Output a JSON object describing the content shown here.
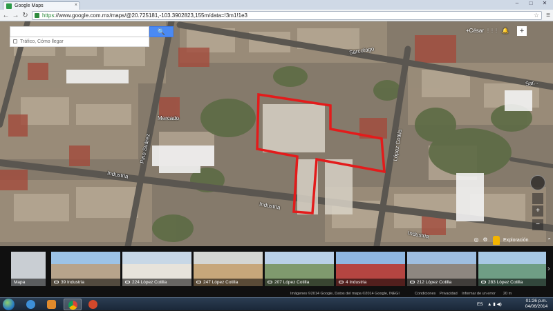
{
  "browser": {
    "tab_title": "Google Maps",
    "tab_close": "×",
    "url_scheme": "https",
    "url_rest": "://www.google.com.mx/maps/@20.725181,-103.3902823,155m/data=!3m1!1e3",
    "back": "←",
    "forward": "→",
    "reload": "↻",
    "star": "☆",
    "menu": "≡",
    "window_min": "–",
    "window_max": "□",
    "window_close": "✕"
  },
  "maps": {
    "search_placeholder": "",
    "search_button": "🔍",
    "traffic_label": "Tráfico, Cómo llegar",
    "user": "+César",
    "apps_icon": "⋮⋮⋮",
    "notif_icon": "🔔",
    "share_plus": "+",
    "explore_label": "Exploración",
    "explore_chevron": "⌃",
    "zoom_in": "+",
    "zoom_out": "−"
  },
  "streets": [
    {
      "name": "Sarcofago"
    },
    {
      "name": "Sar..."
    },
    {
      "name": "Industria"
    },
    {
      "name": "Industria"
    },
    {
      "name": "Industria"
    },
    {
      "name": "López Cotilla"
    },
    {
      "name": "Pino Suárez"
    },
    {
      "name": "Mercado"
    }
  ],
  "filmstrip": {
    "items": [
      {
        "caption": "Mapa",
        "sky": "#c9ced3",
        "bld": "#e9ebec"
      },
      {
        "caption": "39 Industria",
        "sky": "#9cc3e6",
        "bld": "#b7a48b"
      },
      {
        "caption": "224 López Cotilla",
        "sky": "#c7d7e6",
        "bld": "#e7e3db"
      },
      {
        "caption": "247 López Cotilla",
        "sky": "#d4d6d3",
        "bld": "#c7a77a"
      },
      {
        "caption": "207 López Cotilla",
        "sky": "#b9d0e8",
        "bld": "#7f9a6e"
      },
      {
        "caption": "4 Industria",
        "sky": "#8fb7e1",
        "bld": "#b54541"
      },
      {
        "caption": "212 López Cotilla",
        "sky": "#9ebee0",
        "bld": "#8e8780"
      },
      {
        "caption": "283 López Cotilla",
        "sky": "#a7c8e4",
        "bld": "#6f9e85"
      }
    ],
    "next": "›"
  },
  "footer": {
    "imagery": "Imágenes ©2014 Google, Datos del mapa ©2014 Google, INEGI",
    "terms": "Condiciones",
    "privacy": "Privacidad",
    "report": "Informar de un error",
    "scale": "20 m"
  },
  "taskbar": {
    "language": "ES",
    "time": "01:26 p.m.",
    "date": "04/06/2014"
  },
  "colors": {
    "boundary": "#e31b1b",
    "search_blue": "#4a8af4"
  }
}
